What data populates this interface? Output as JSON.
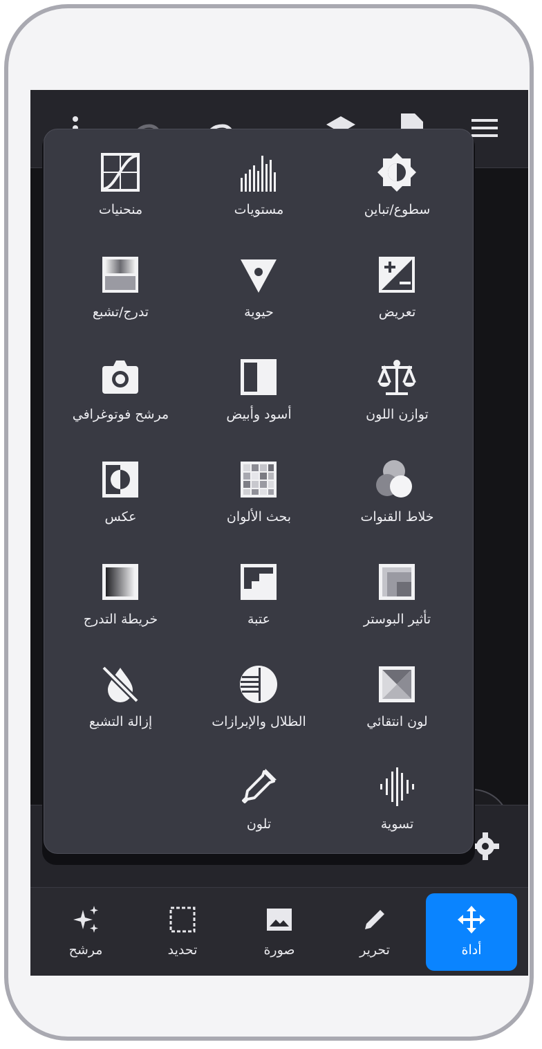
{
  "menu": {
    "items": [
      {
        "label": "سطوع/تباين",
        "icon": "brightness-contrast-icon"
      },
      {
        "label": "مستويات",
        "icon": "levels-icon"
      },
      {
        "label": "منحنيات",
        "icon": "curves-icon"
      },
      {
        "label": "تعريض",
        "icon": "exposure-icon"
      },
      {
        "label": "حيوية",
        "icon": "vibrance-icon"
      },
      {
        "label": "تدرج/تشبع",
        "icon": "hue-saturation-icon"
      },
      {
        "label": "توازن اللون",
        "icon": "color-balance-icon"
      },
      {
        "label": "أسود وأبيض",
        "icon": "black-white-icon"
      },
      {
        "label": "مرشح فوتوغرافي",
        "icon": "photo-filter-icon"
      },
      {
        "label": "خلاط القنوات",
        "icon": "channel-mixer-icon"
      },
      {
        "label": "بحث الألوان",
        "icon": "color-lookup-icon"
      },
      {
        "label": "عكس",
        "icon": "invert-icon"
      },
      {
        "label": "تأثير البوستر",
        "icon": "posterize-icon"
      },
      {
        "label": "عتبة",
        "icon": "threshold-icon"
      },
      {
        "label": "خريطة التدرج",
        "icon": "gradient-map-icon"
      },
      {
        "label": "لون انتقائي",
        "icon": "selective-color-icon"
      },
      {
        "label": "الظلال والإبرازات",
        "icon": "shadows-highlights-icon"
      },
      {
        "label": "إزالة التشبع",
        "icon": "desaturate-icon"
      },
      {
        "label": "تسوية",
        "icon": "equalize-icon"
      },
      {
        "label": "تلون",
        "icon": "colorize-icon"
      }
    ]
  },
  "bottom_nav": {
    "items": [
      {
        "label": "أداة",
        "icon": "move-icon",
        "active": true
      },
      {
        "label": "تحرير",
        "icon": "pencil-icon",
        "active": false
      },
      {
        "label": "صورة",
        "icon": "image-icon",
        "active": false
      },
      {
        "label": "تحديد",
        "icon": "selection-icon",
        "active": false
      },
      {
        "label": "مرشح",
        "icon": "sparkles-icon",
        "active": false
      }
    ]
  },
  "colors": {
    "accent": "#0a84ff",
    "menu_bg": "#393a43",
    "bar_bg": "#25252b"
  }
}
